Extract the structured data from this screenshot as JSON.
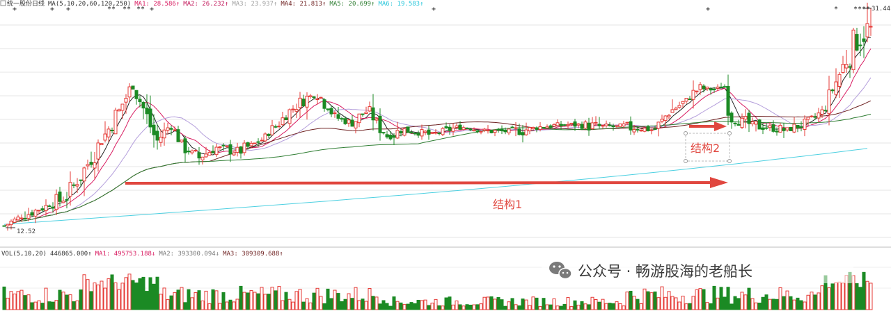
{
  "chart_data": {
    "type": "candlestick",
    "title": "统一股份日线",
    "price_panel": {
      "indicator_label": "MA(5,10,20,60,120,250)",
      "ma_values": [
        {
          "label": "MA1",
          "value": "28.586↑",
          "color": "#d81b60"
        },
        {
          "label": "MA2",
          "value": "26.232↑",
          "color": "#c2185b"
        },
        {
          "label": "MA3",
          "value": "23.937↑",
          "color": "#b0b0b0"
        },
        {
          "label": "MA4",
          "value": "21.813↑",
          "color": "#6d1f1f"
        },
        {
          "label": "MA5",
          "value": "20.699↑",
          "color": "#2e7d32"
        },
        {
          "label": "MA6",
          "value": "19.583↑",
          "color": "#4dd0e1"
        }
      ],
      "low_label": "12.52",
      "high_label": "31.44",
      "low_value": 12.52,
      "high_value": 31.44
    },
    "volume_panel": {
      "indicator_label": "VOL(5,10,20)",
      "vol_value": "446865.000↑",
      "ma_values": [
        {
          "label": "MA1",
          "value": "495753.188↓",
          "color": "#d81b60"
        },
        {
          "label": "MA2",
          "value": "393300.094↓",
          "color": "#888888"
        },
        {
          "label": "MA3",
          "value": "309309.688↑",
          "color": "#6d1f1f"
        }
      ]
    },
    "annotations": [
      {
        "label": "结构1",
        "kind": "arrow",
        "color": "#e0473f"
      },
      {
        "label": "结构2",
        "kind": "arrow-box",
        "color": "#e0473f"
      }
    ],
    "series_style": {
      "up_color": "#e53935",
      "down_color": "#1b8a24"
    }
  },
  "watermark": {
    "text": "公众号 · 畅游股海的老船长"
  }
}
